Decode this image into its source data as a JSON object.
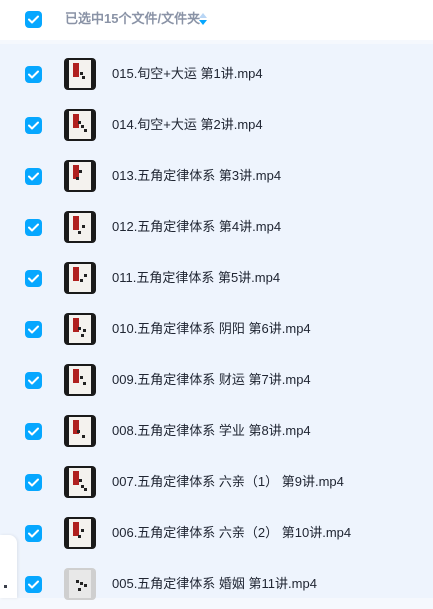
{
  "header": {
    "selection_label": "已选中15个文件/文件夹",
    "select_all_checked": true,
    "sort_icon": "sort-icon"
  },
  "files": [
    {
      "name": "015.旬空+大运 第1讲.mp4",
      "checked": true
    },
    {
      "name": "014.旬空+大运 第2讲.mp4",
      "checked": true
    },
    {
      "name": "013.五角定律体系 第3讲.mp4",
      "checked": true
    },
    {
      "name": "012.五角定律体系 第4讲.mp4",
      "checked": true
    },
    {
      "name": "011.五角定律体系 第5讲.mp4",
      "checked": true
    },
    {
      "name": "010.五角定律体系 阴阳 第6讲.mp4",
      "checked": true
    },
    {
      "name": "009.五角定律体系 财运 第7讲.mp4",
      "checked": true
    },
    {
      "name": "008.五角定律体系 学业 第8讲.mp4",
      "checked": true
    },
    {
      "name": "007.五角定律体系 六亲（1） 第9讲.mp4",
      "checked": true
    },
    {
      "name": "006.五角定律体系 六亲（2） 第10讲.mp4",
      "checked": true
    },
    {
      "name": "005.五角定律体系 婚姻 第11讲.mp4",
      "checked": true
    }
  ],
  "colors": {
    "accent": "#06a7ff",
    "list_bg": "#eef4fd",
    "text": "#202633",
    "header_text": "#8a93a6"
  }
}
